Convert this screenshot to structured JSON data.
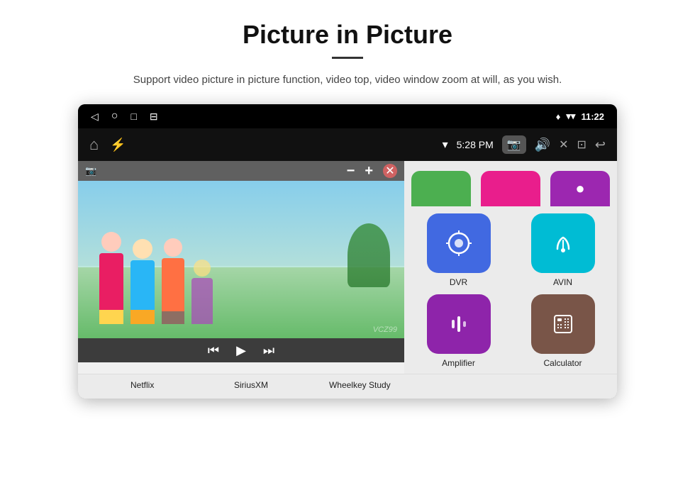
{
  "header": {
    "title": "Picture in Picture",
    "subtitle": "Support video picture in picture function, video top, video window zoom at will, as you wish."
  },
  "status_bar": {
    "back_icon": "◁",
    "circle_icon": "○",
    "square_icon": "□",
    "menu_icon": "⊟",
    "location_icon": "♦",
    "wifi_icon": "▾",
    "time": "11:22"
  },
  "toolbar": {
    "home_icon": "⌂",
    "usb_icon": "⚡",
    "wifi_label": "WiFi",
    "time": "5:28 PM",
    "camera_icon": "📷",
    "volume_icon": "🔊",
    "close_icon": "✕",
    "pip_icon": "⊡",
    "back_icon": "↩"
  },
  "pip": {
    "camera_icon": "📷",
    "minus": "−",
    "plus": "+",
    "close": "✕",
    "prev": "⏮",
    "play": "⏭",
    "next": "⏭"
  },
  "apps": {
    "top_partial": [
      {
        "id": "netflix",
        "color": "#4caf50",
        "label": "Netflix"
      },
      {
        "id": "siriusxm",
        "color": "#e91e8c",
        "label": "SiriusXM"
      },
      {
        "id": "wheelkey",
        "color": "#9c27b0",
        "label": "Wheelkey Study"
      }
    ],
    "right_top": [
      {
        "id": "dvr",
        "color": "#4169e1",
        "label": "DVR"
      },
      {
        "id": "avin",
        "color": "#00bcd4",
        "label": "AVIN"
      }
    ],
    "right_bottom": [
      {
        "id": "amplifier",
        "color": "#8e24aa",
        "label": "Amplifier"
      },
      {
        "id": "calculator",
        "color": "#795548",
        "label": "Calculator"
      }
    ]
  },
  "watermark": "VCZ99"
}
